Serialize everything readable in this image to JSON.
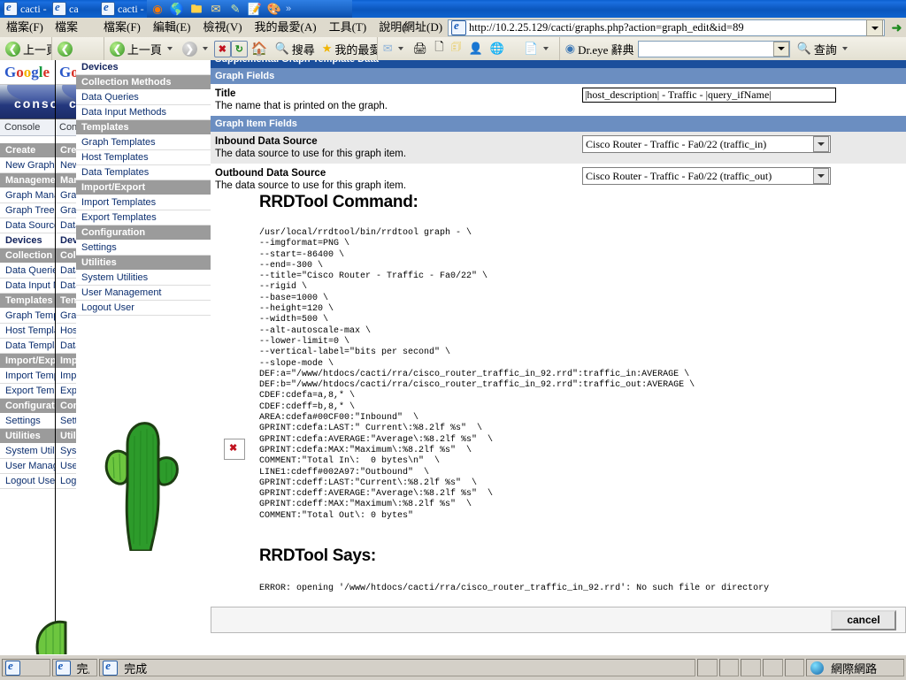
{
  "window": {
    "tabs": [
      {
        "title": "cacti - "
      },
      {
        "title": "ca"
      },
      {
        "title": "cacti - Micr"
      }
    ],
    "quicklaunch_icons": [
      "media-player-icon",
      "ie-browser-icon",
      "folders-icon",
      "mail-icon",
      "pencil-icon",
      "notes-icon",
      "paint-icon"
    ],
    "quicklaunch_more": "»"
  },
  "menubar": {
    "group1": [
      "檔案(F)"
    ],
    "group2": [
      "檔案"
    ],
    "group3": [
      "檔案(F)",
      "編輯(E)",
      "檢視(V)",
      "我的最愛(A)",
      "工具(T)",
      "說明(H)"
    ],
    "address_label": "網址(D)"
  },
  "address": {
    "url": "http://10.2.25.129/cacti/graphs.php?action=graph_edit&id=89",
    "dropdown_icon": "chevron-down-icon",
    "go_icon": "go-arrow-icon"
  },
  "toolbar": {
    "back_label": "上一頁",
    "back_label_2": "上一頁",
    "search_label": "搜尋",
    "favorites_label": "我的最愛",
    "dreye_label": "Dr.eye 辭典",
    "query_label": "查詢",
    "dreye_input_value": "",
    "icons": [
      "back-icon",
      "forward-icon",
      "stop-icon",
      "refresh-icon",
      "home-icon",
      "search-icon",
      "favorites-star-icon",
      "history-icon",
      "mail-icon",
      "print-icon",
      "edit-icon",
      "notes-icon",
      "messenger-icon",
      "globe-icon",
      "pdf-icon",
      "dreye-icon",
      "query-icon"
    ]
  },
  "google_bar": {
    "parts": [
      {
        "ch": "G",
        "cls": "b"
      },
      {
        "ch": "o",
        "cls": "r"
      },
      {
        "ch": "o",
        "cls": "y"
      },
      {
        "ch": "g",
        "cls": "b"
      },
      {
        "ch": "l",
        "cls": "g"
      },
      {
        "ch": "e",
        "cls": "r"
      }
    ]
  },
  "sidebar": {
    "banner_text": "console",
    "console_link": "Console",
    "items": [
      {
        "label": "Create",
        "type": "header"
      },
      {
        "label": "New Graphs",
        "type": "item"
      },
      {
        "label": "Management",
        "type": "header"
      },
      {
        "label": "Graph Management",
        "type": "item"
      },
      {
        "label": "Graph Trees",
        "type": "item"
      },
      {
        "label": "Data Sources",
        "type": "item"
      },
      {
        "label": "Devices",
        "type": "item",
        "selected": true
      },
      {
        "label": "Collection Methods",
        "type": "header"
      },
      {
        "label": "Data Queries",
        "type": "item"
      },
      {
        "label": "Data Input Methods",
        "type": "item"
      },
      {
        "label": "Templates",
        "type": "header"
      },
      {
        "label": "Graph Templates",
        "type": "item"
      },
      {
        "label": "Host Templates",
        "type": "item"
      },
      {
        "label": "Data Templates",
        "type": "item"
      },
      {
        "label": "Import/Export",
        "type": "header"
      },
      {
        "label": "Import Templates",
        "type": "item"
      },
      {
        "label": "Export Templates",
        "type": "item"
      },
      {
        "label": "Configuration",
        "type": "header"
      },
      {
        "label": "Settings",
        "type": "item"
      },
      {
        "label": "Utilities",
        "type": "header"
      },
      {
        "label": "System Utilities",
        "type": "item"
      },
      {
        "label": "User Management",
        "type": "item"
      },
      {
        "label": "Logout User",
        "type": "item"
      }
    ]
  },
  "main": {
    "supplemental_header": "Supplemental Graph Template Data",
    "graph_fields_header": "Graph Fields",
    "title_field": {
      "label": "Title",
      "description": "The name that is printed on the graph.",
      "value": "|host_description| - Traffic - |query_ifName|"
    },
    "graph_item_fields_header": "Graph Item Fields",
    "inbound": {
      "label": "Inbound Data Source",
      "description": "The data source to use for this graph item.",
      "value": "Cisco Router - Traffic - Fa0/22 (traffic_in)"
    },
    "outbound": {
      "label": "Outbound Data Source",
      "description": "The data source to use for this graph item.",
      "value": "Cisco Router - Traffic - Fa0/22 (traffic_out)"
    },
    "rrdtool_command_heading": "RRDTool Command:",
    "rrdtool_command": "/usr/local/rrdtool/bin/rrdtool graph - \\\n--imgformat=PNG \\\n--start=-86400 \\\n--end=-300 \\\n--title=\"Cisco Router - Traffic - Fa0/22\" \\\n--rigid \\\n--base=1000 \\\n--height=120 \\\n--width=500 \\\n--alt-autoscale-max \\\n--lower-limit=0 \\\n--vertical-label=\"bits per second\" \\\n--slope-mode \\\nDEF:a=\"/www/htdocs/cacti/rra/cisco_router_traffic_in_92.rrd\":traffic_in:AVERAGE \\\nDEF:b=\"/www/htdocs/cacti/rra/cisco_router_traffic_in_92.rrd\":traffic_out:AVERAGE \\\nCDEF:cdefa=a,8,* \\\nCDEF:cdeff=b,8,* \\\nAREA:cdefa#00CF00:\"Inbound\"  \\\nGPRINT:cdefa:LAST:\" Current\\:%8.2lf %s\"  \\\nGPRINT:cdefa:AVERAGE:\"Average\\:%8.2lf %s\"  \\\nGPRINT:cdefa:MAX:\"Maximum\\:%8.2lf %s\"  \\\nCOMMENT:\"Total In\\:  0 bytes\\n\"  \\\nLINE1:cdeff#002A97:\"Outbound\"  \\\nGPRINT:cdeff:LAST:\"Current\\:%8.2lf %s\"  \\\nGPRINT:cdeff:AVERAGE:\"Average\\:%8.2lf %s\"  \\\nGPRINT:cdeff:MAX:\"Maximum\\:%8.2lf %s\"  \\\nCOMMENT:\"Total Out\\: 0 bytes\"",
    "rrdtool_says_heading": "RRDTool Says:",
    "rrdtool_says": "ERROR: opening '/www/htdocs/cacti/rra/cisco_router_traffic_in_92.rrd': No such file or directory",
    "cancel_button": "cancel",
    "broken_image_icon": "broken-image-icon",
    "cactus_icon": "cactus-logo-icon"
  },
  "statusbar": {
    "done_label": "完成",
    "zone_label": "網際網路",
    "globe_icon": "internet-zone-icon"
  },
  "colors": {
    "title_blue": "#0b5fce",
    "header_dark": "#1b4f9c",
    "header_mid": "#6b8ec1",
    "nav_header_gray": "#9b9b9b",
    "link_blue": "#0b2e6f"
  }
}
